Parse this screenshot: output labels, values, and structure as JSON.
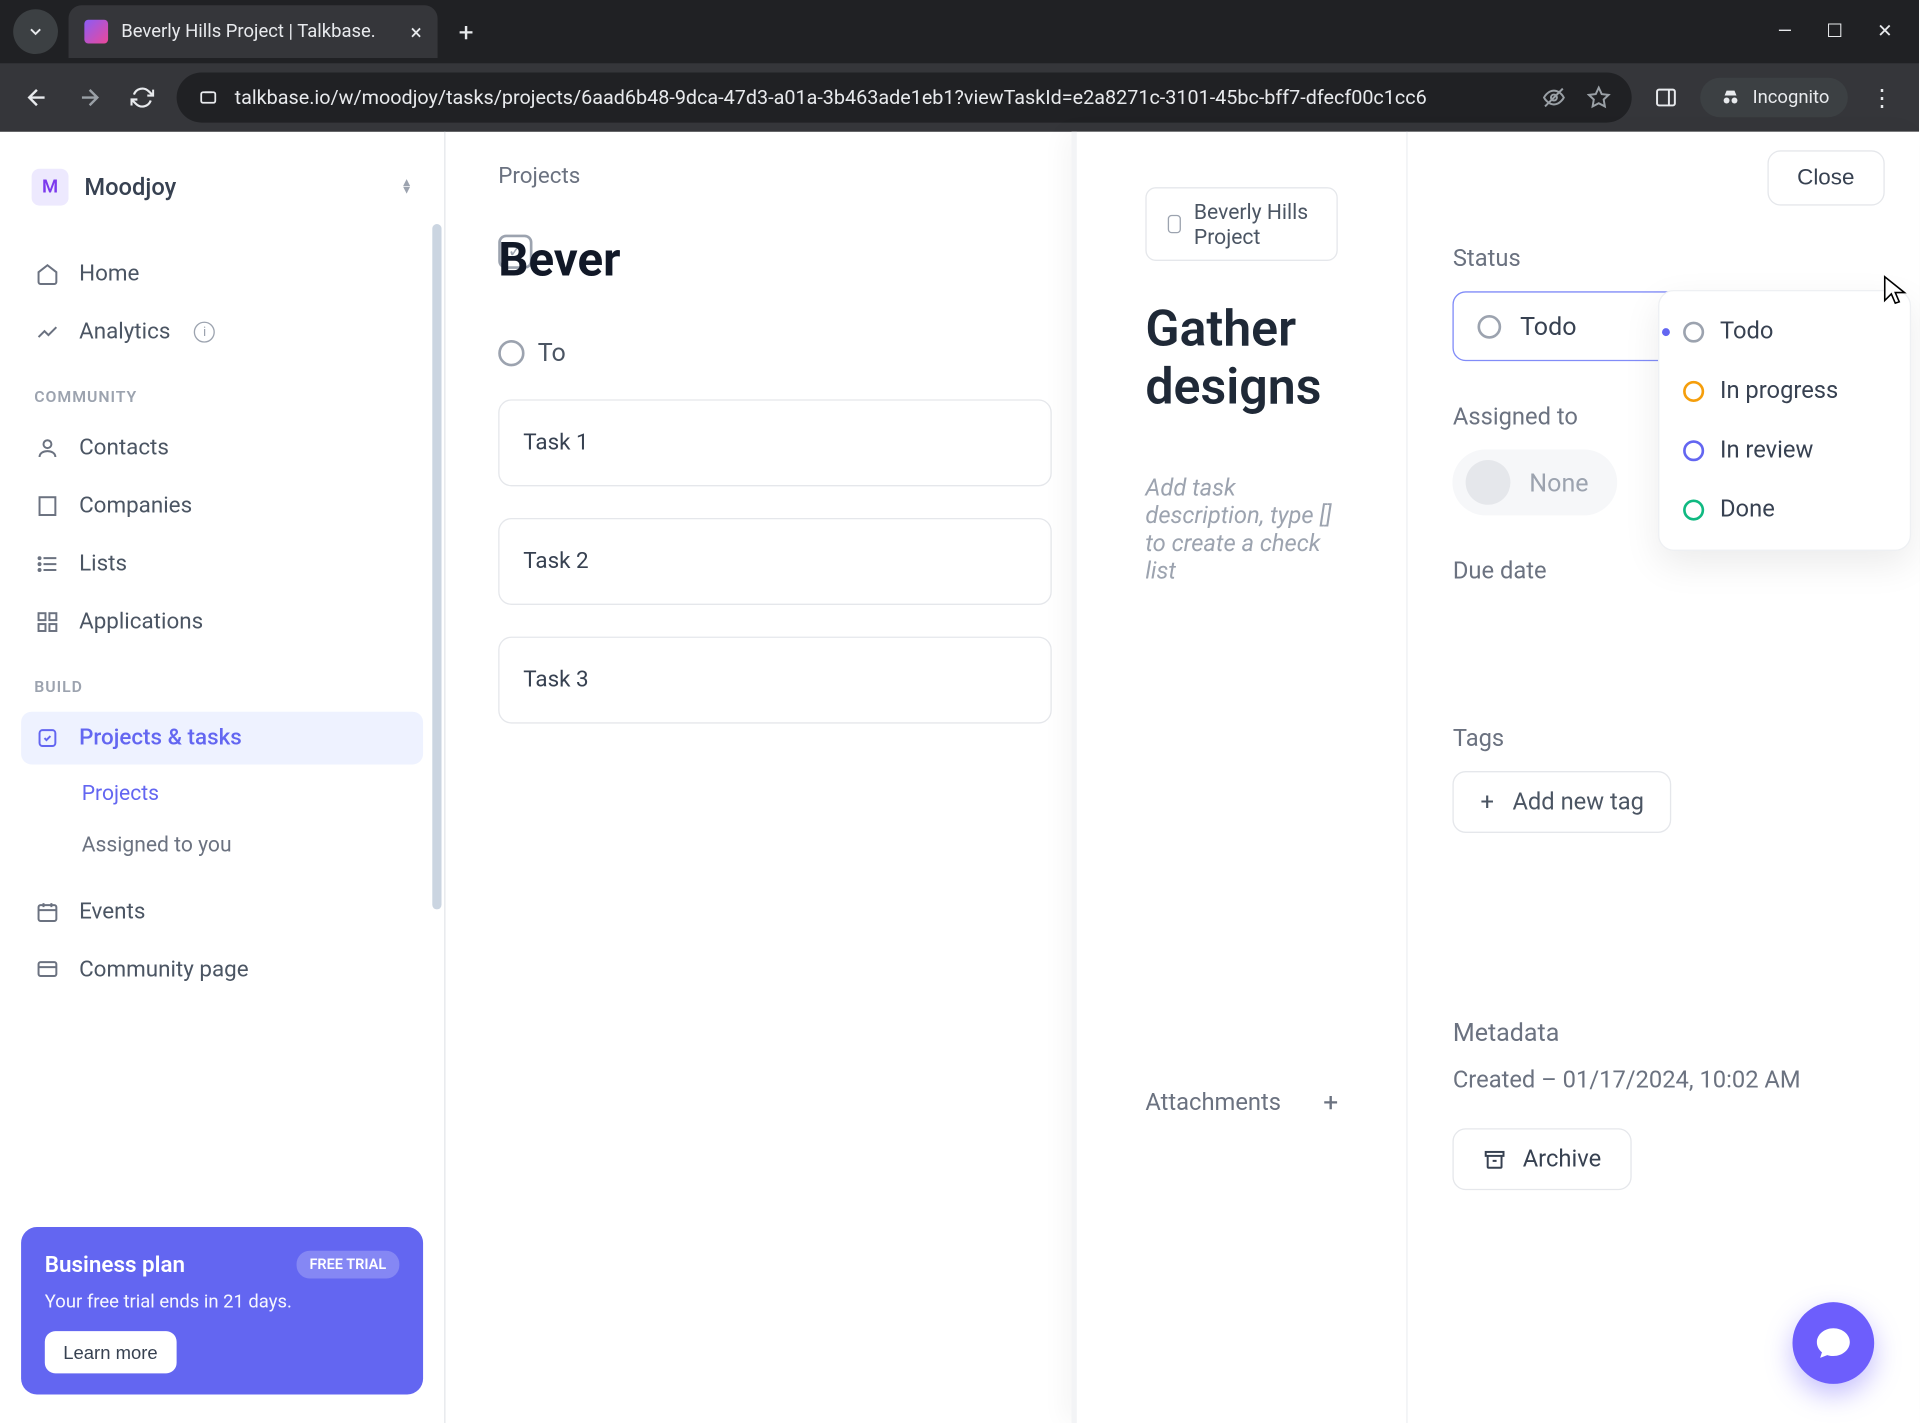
{
  "browser": {
    "tab_title": "Beverly Hills Project | Talkbase.",
    "url": "talkbase.io/w/moodjoy/tasks/projects/6aad6b48-9dca-47d3-a01a-3b463ade1eb1?viewTaskId=e2a8271c-3101-45bc-bff7-dfecf00c1cc6",
    "incognito": "Incognito"
  },
  "workspace": {
    "initial": "M",
    "name": "Moodjoy"
  },
  "nav": {
    "home": "Home",
    "analytics": "Analytics",
    "section_community": "COMMUNITY",
    "contacts": "Contacts",
    "companies": "Companies",
    "lists": "Lists",
    "applications": "Applications",
    "section_build": "BUILD",
    "projects_tasks": "Projects & tasks",
    "sub_projects": "Projects",
    "sub_assigned": "Assigned to you",
    "events": "Events",
    "community_page": "Community page"
  },
  "trial": {
    "title": "Business plan",
    "badge": "FREE TRIAL",
    "subtitle": "Your free trial ends in 21 days.",
    "button": "Learn more"
  },
  "background": {
    "crumb": "Projects",
    "heading": "Bever",
    "column": "To",
    "tasks": [
      "Task 1",
      "Task 2",
      "Task 3"
    ]
  },
  "task": {
    "project_chip": "Beverly Hills Project",
    "title": "Gather designs",
    "description_placeholder": "Add task description, type [] to create a check list",
    "attachments_label": "Attachments",
    "close": "Close"
  },
  "side": {
    "status_label": "Status",
    "status_value": "Todo",
    "status_options": [
      {
        "label": "Todo",
        "color": "#9ca3af",
        "selected": true
      },
      {
        "label": "In progress",
        "color": "#f59e0b",
        "selected": false
      },
      {
        "label": "In review",
        "color": "#6366f1",
        "selected": false
      },
      {
        "label": "Done",
        "color": "#10b981",
        "selected": false
      }
    ],
    "assigned_label": "Assigned to",
    "assigned_value": "None",
    "due_label": "Due date",
    "tags_label": "Tags",
    "add_tag": "Add new tag",
    "metadata_label": "Metadata",
    "created_line": "Created – 01/17/2024, 10:02 AM",
    "archive": "Archive"
  }
}
